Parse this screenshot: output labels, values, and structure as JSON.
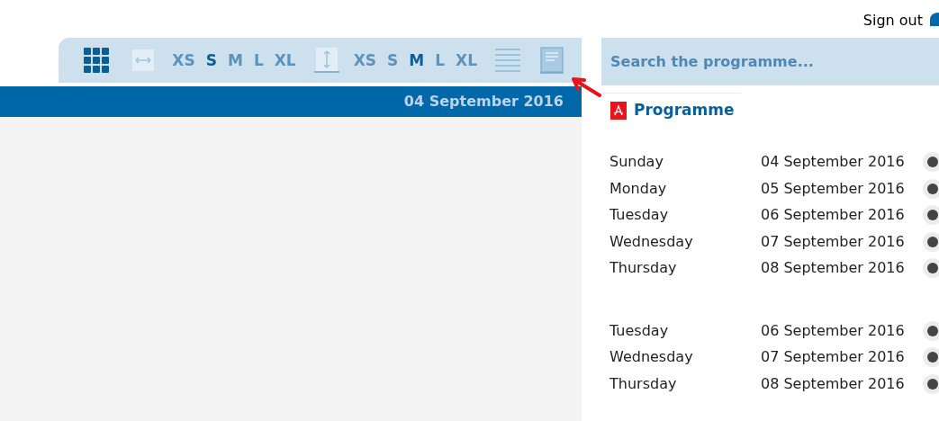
{
  "header": {
    "sign_out": "Sign out"
  },
  "toolbar": {
    "width_sizes": [
      {
        "label": "XS",
        "selected": false
      },
      {
        "label": "S",
        "selected": true
      },
      {
        "label": "M",
        "selected": false
      },
      {
        "label": "L",
        "selected": false
      },
      {
        "label": "XL",
        "selected": false
      }
    ],
    "height_sizes": [
      {
        "label": "XS",
        "selected": false
      },
      {
        "label": "S",
        "selected": false
      },
      {
        "label": "M",
        "selected": true
      },
      {
        "label": "L",
        "selected": false
      },
      {
        "label": "XL",
        "selected": false
      }
    ]
  },
  "date_bar": "04 September 2016",
  "search": {
    "placeholder": "Search the programme..."
  },
  "programme_link": "Programme",
  "schedule_groups": [
    [
      {
        "day": "Sunday",
        "date": "04 September 2016"
      },
      {
        "day": "Monday",
        "date": "05 September 2016"
      },
      {
        "day": "Tuesday",
        "date": "06 September 2016"
      },
      {
        "day": "Wednesday",
        "date": "07 September 2016"
      },
      {
        "day": "Thursday",
        "date": "08 September 2016"
      }
    ],
    [
      {
        "day": "Tuesday",
        "date": "06 September 2016"
      },
      {
        "day": "Wednesday",
        "date": "07 September 2016"
      },
      {
        "day": "Thursday",
        "date": "08 September 2016"
      }
    ]
  ]
}
